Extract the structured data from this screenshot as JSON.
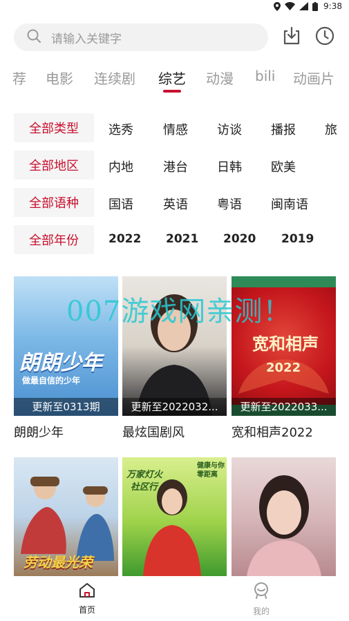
{
  "status_bar": {
    "time": "9:38",
    "icons": [
      "location-icon",
      "wifi-icon",
      "signal-icon",
      "battery-icon"
    ]
  },
  "search": {
    "placeholder": "请输入关键字"
  },
  "header_icons": [
    "download-icon",
    "history-clock-icon"
  ],
  "tabs": [
    {
      "label": "荐"
    },
    {
      "label": "电影"
    },
    {
      "label": "连续剧"
    },
    {
      "label": "综艺",
      "active": true
    },
    {
      "label": "动漫"
    },
    {
      "label": "bili"
    },
    {
      "label": "动画片"
    }
  ],
  "filters": [
    {
      "label": "全部类型",
      "options": [
        "选秀",
        "情感",
        "访谈",
        "播报",
        "旅"
      ]
    },
    {
      "label": "全部地区",
      "options": [
        "内地",
        "港台",
        "日韩",
        "欧美"
      ]
    },
    {
      "label": "全部语种",
      "options": [
        "国语",
        "英语",
        "粤语",
        "闽南语"
      ]
    },
    {
      "label": "全部年份",
      "options": [
        "2022",
        "2021",
        "2020",
        "2019"
      ]
    }
  ],
  "cards": [
    {
      "title": "朗朗少年",
      "episode": "更新至0313期",
      "poster_text": [
        "朗朗少年",
        "做最自信的少年"
      ]
    },
    {
      "title": "最炫国剧风",
      "episode": "更新至2022032..."
    },
    {
      "title": "宽和相声2022",
      "episode": "更新至2022033...",
      "poster_text": [
        "宽和相声",
        "2022"
      ]
    },
    {
      "title": "",
      "episode": "",
      "poster_text": [
        "劳动最光荣"
      ]
    },
    {
      "title": "",
      "episode": "",
      "poster_text": [
        "万家灯火",
        "社区行",
        "健康与你零距离"
      ]
    },
    {
      "title": "",
      "episode": ""
    }
  ],
  "watermark": "007游戏网亲测！",
  "bottom_nav": [
    {
      "label": "首页",
      "icon": "home-icon",
      "active": true
    },
    {
      "label": "我的",
      "icon": "profile-icon",
      "active": false
    }
  ],
  "colors": {
    "accent": "#c8102e",
    "inactive": "#9a9a9a",
    "text": "#222222",
    "chip_bg": "#f5f5f5"
  }
}
